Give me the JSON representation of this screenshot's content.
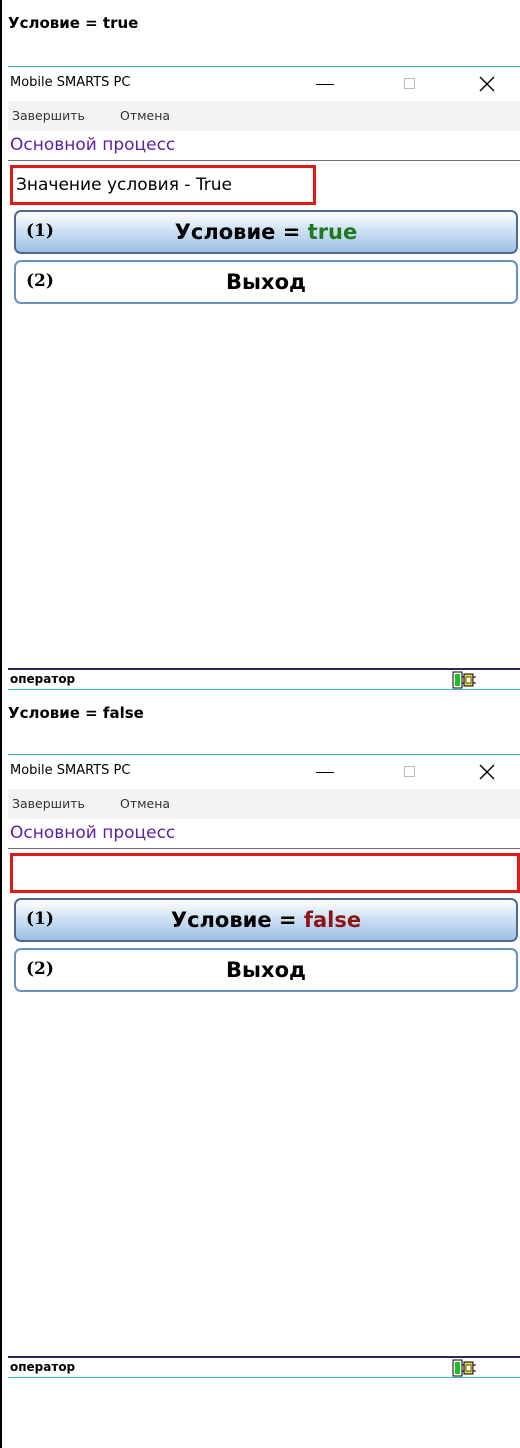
{
  "sections": [
    {
      "heading": "Условие = true",
      "window_title": "Mobile SMARTS PC",
      "menu": {
        "finish": "Завершить",
        "cancel": "Отмена"
      },
      "process_title": "Основной процесс",
      "condition_text": "Значение условия - True",
      "options": [
        {
          "number": "(1)",
          "label_prefix": "Условие = ",
          "label_value": "true",
          "value_color": "#1f7a1f",
          "selected": true
        },
        {
          "number": "(2)",
          "label": "Выход",
          "selected": false
        }
      ],
      "status_user": "оператор",
      "icons": {
        "window_min": "minimize-icon",
        "window_max": "maximize-icon",
        "window_close": "close-icon",
        "status": "battery-icon"
      }
    },
    {
      "heading": "Условие = false",
      "window_title": "Mobile SMARTS PC",
      "menu": {
        "finish": "Завершить",
        "cancel": "Отмена"
      },
      "process_title": "Основной процесс",
      "condition_text": "",
      "options": [
        {
          "number": "(1)",
          "label_prefix": "Условие = ",
          "label_value": "false",
          "value_color": "#8b1414",
          "selected": true
        },
        {
          "number": "(2)",
          "label": "Выход",
          "selected": false
        }
      ],
      "status_user": "оператор",
      "icons": {
        "window_min": "minimize-icon",
        "window_max": "maximize-icon",
        "window_close": "close-icon",
        "status": "battery-icon"
      }
    }
  ],
  "colors": {
    "accent_line": "#3fb2c4",
    "highlight_border": "#e01a1a",
    "process_title": "#5b1ea7"
  }
}
